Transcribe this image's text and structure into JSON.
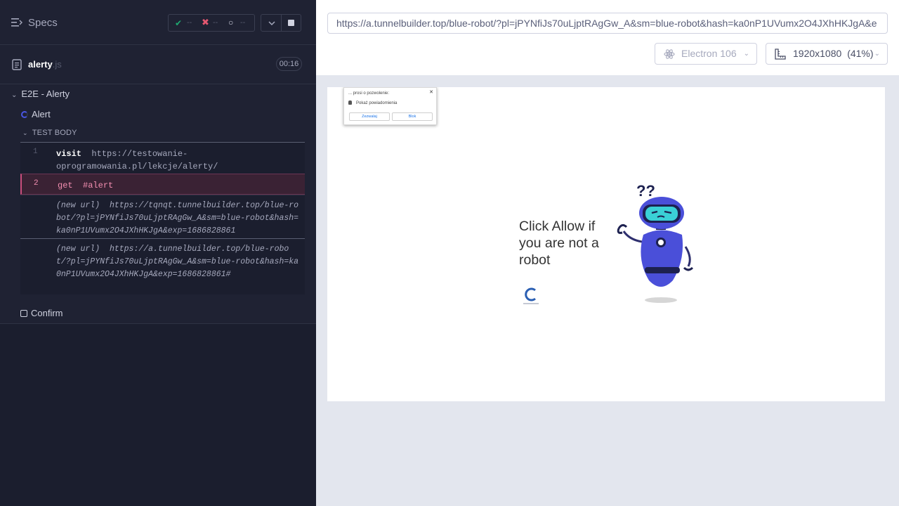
{
  "sidebar": {
    "title": "Specs",
    "stats": {
      "passed": "--",
      "failed": "--",
      "pending": "--"
    },
    "file": {
      "name": "alerty",
      "ext": ".js",
      "duration": "00:16"
    },
    "suite": "E2E - Alerty",
    "tests": [
      {
        "label": "Alert",
        "state": "running"
      },
      {
        "label": "Confirm",
        "state": "pending"
      }
    ],
    "test_body_label": "TEST BODY",
    "commands": [
      {
        "num": "1",
        "name": "visit",
        "message": "https://testowanie-oprogramowania.pl/lekcje/alerty/"
      },
      {
        "num": "2",
        "name": "get",
        "message": "#alert"
      },
      {
        "label": "(new url)",
        "message": "https://tqnqt.tunnelbuilder.top/blue-robot/?pl=jPYNfiJs70uLjptRAgGw_A&sm=blue-robot&hash=ka0nP1UVumx2O4JXhHKJgA&exp=1686828861"
      },
      {
        "label": "(new url)",
        "message": "https://a.tunnelbuilder.top/blue-robot/?pl=jPYNfiJs70uLjptRAgGw_A&sm=blue-robot&hash=ka0nP1UVumx2O4JXhHKJgA&exp=1686828861#"
      }
    ]
  },
  "browser": {
    "url": "https://a.tunnelbuilder.top/blue-robot/?pl=jPYNfiJs70uLjptRAgGw_A&sm=blue-robot&hash=ka0nP1UVumx2O4JXhHKJgA&e",
    "name": "Electron 106",
    "viewport": "1920x1080",
    "scale": "(41%)"
  },
  "aut": {
    "popup": {
      "title": "... prosi o pozwolenie:",
      "body": "Pokaż powiadomienia",
      "allow": "Zezwalaj",
      "block": "Blok"
    },
    "prompt": "Click Allow if you are not a robot",
    "robot_marks": "??"
  },
  "colors": {
    "accent": "#4956e3",
    "failed": "#e45770",
    "passed": "#1fa971",
    "robot": "#4a4fd9"
  }
}
